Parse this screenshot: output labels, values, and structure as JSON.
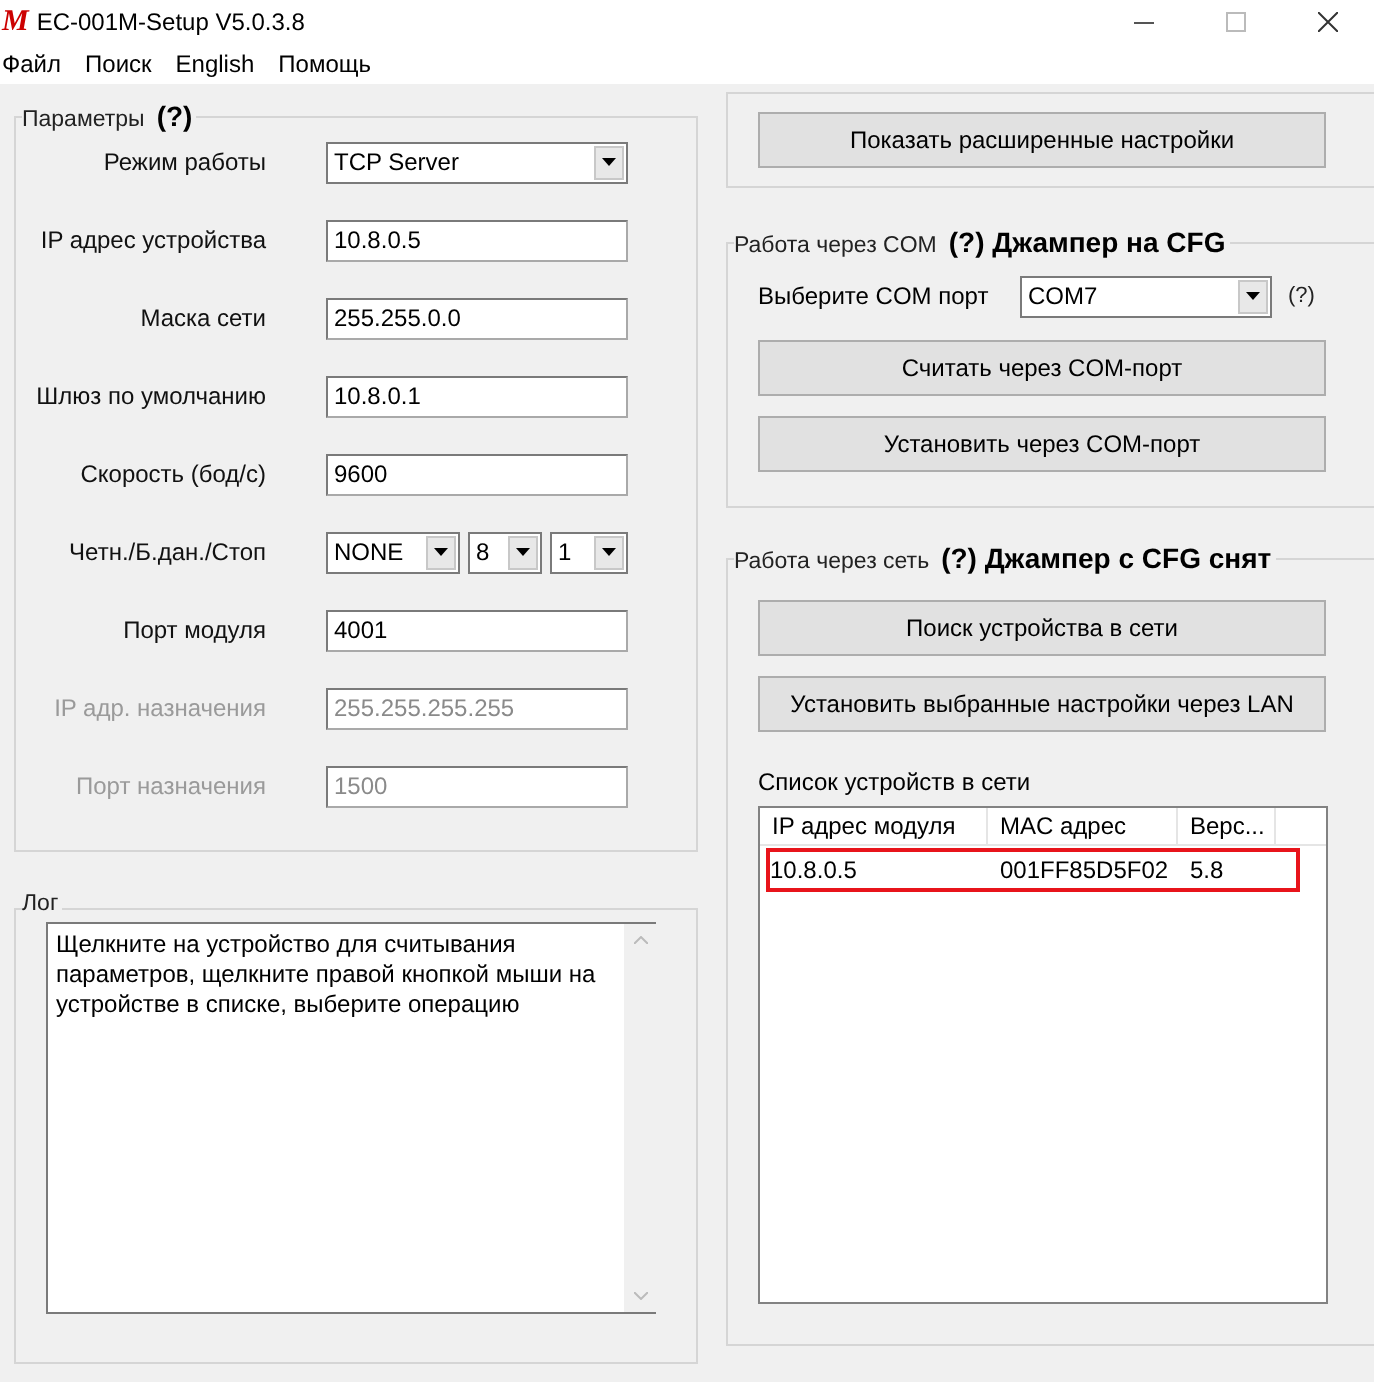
{
  "window": {
    "logo": "M",
    "title": "EC-001M-Setup V5.0.3.8"
  },
  "menu": [
    {
      "label": "Файл"
    },
    {
      "label": "Поиск"
    },
    {
      "label": "English"
    },
    {
      "label": "Помощь"
    }
  ],
  "parameters": {
    "title": "Параметры",
    "help": "(?)",
    "rows": [
      {
        "kind": "dropdown",
        "label": "Режим работы",
        "values": [
          "TCP Server"
        ],
        "disabled": false
      },
      {
        "kind": "field",
        "label": "IP адрес устройства",
        "values": [
          "10.8.0.5"
        ],
        "disabled": false
      },
      {
        "kind": "field",
        "label": "Маска сети",
        "values": [
          "255.255.0.0"
        ],
        "disabled": false
      },
      {
        "kind": "field",
        "label": "Шлюз по умолчанию",
        "values": [
          "10.8.0.1"
        ],
        "disabled": false
      },
      {
        "kind": "field",
        "label": "Скорость (бод/с)",
        "values": [
          "9600"
        ],
        "disabled": false
      },
      {
        "kind": "dropdown",
        "label": "Четн./Б.дан./Стоп",
        "values": [
          "NONE",
          "8",
          "1"
        ],
        "disabled": false
      },
      {
        "kind": "field",
        "label": "Порт модуля",
        "values": [
          "4001"
        ],
        "disabled": false
      },
      {
        "kind": "field",
        "label": "IP адр. назначения",
        "values": [
          "255.255.255.255"
        ],
        "disabled": true
      },
      {
        "kind": "field",
        "label": "Порт назначения",
        "values": [
          "1500"
        ],
        "disabled": true
      }
    ]
  },
  "log": {
    "title": "Лог",
    "text": "Щелкните на устройство для считывания параметров, щелкните правой кнопкой мыши на устройстве в списке, выберите операцию"
  },
  "advanced_button": "Показать расширенные настройки",
  "com": {
    "title": "Работа через COM",
    "note": "(?) Джампер на CFG",
    "port_label": "Выберите COM порт",
    "port": "COM7",
    "help": "(?)",
    "buttons": [
      "Считать через COM-порт",
      "Установить через COM-порт"
    ]
  },
  "network": {
    "title": "Работа через сеть",
    "note": "(?) Джампер с CFG снят",
    "buttons": [
      "Поиск устройства в сети",
      "Установить выбранные настройки через LAN"
    ],
    "list_label": "Список устройств в сети",
    "columns": [
      "IP адрес модуля",
      "MAC адрес",
      "Верс..."
    ],
    "rows": [
      {
        "cells": [
          "10.8.0.5",
          "001FF85D5F02",
          "5.8"
        ],
        "selected": true
      }
    ]
  }
}
